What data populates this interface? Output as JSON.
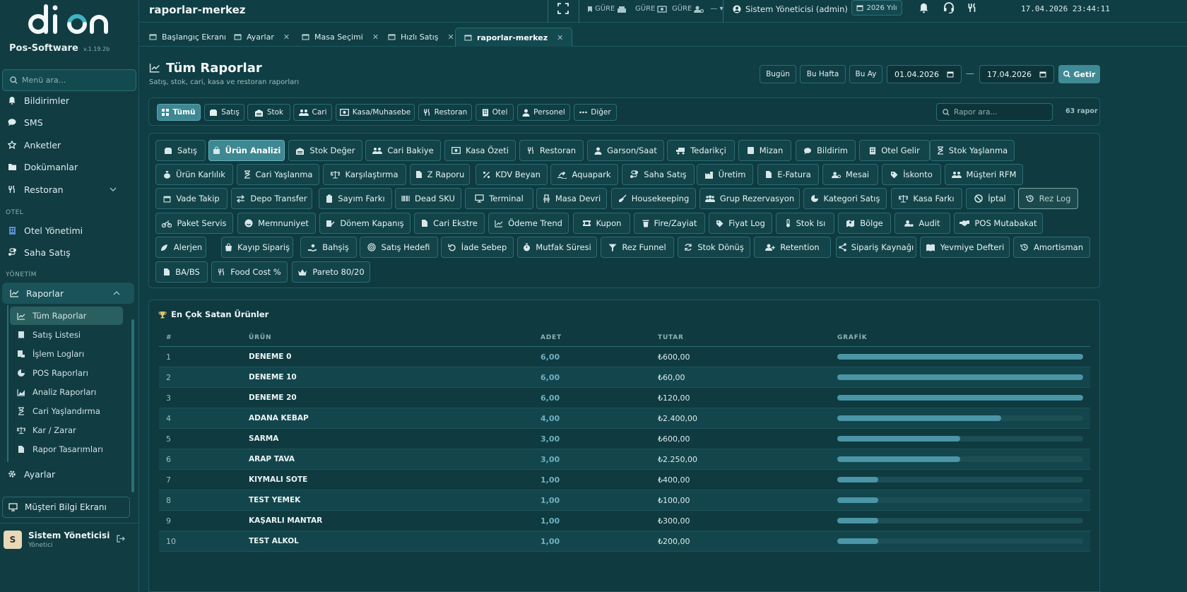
{
  "app": {
    "brand": "Pos-Software",
    "version": "v.1.19.2b"
  },
  "sidebar": {
    "search_placeholder": "Menü ara...",
    "items": [
      {
        "label": "Bildirimler",
        "icon": "bell-icon"
      },
      {
        "label": "SMS",
        "icon": "chat-icon"
      },
      {
        "label": "Anketler",
        "icon": "star-icon"
      },
      {
        "label": "Dokümanlar",
        "icon": "folder-icon"
      },
      {
        "label": "Restoran",
        "icon": "utensils-icon"
      }
    ],
    "section_otel": "OTEL",
    "otel_items": [
      {
        "label": "Otel Yönetimi",
        "icon": "building-icon"
      },
      {
        "label": "Saha Satış",
        "icon": "route-icon"
      }
    ],
    "section_yonetim": "YÖNETİM",
    "raporlar": {
      "label": "Raporlar",
      "icon": "chart-line-icon"
    },
    "sub_items": [
      {
        "label": "Tüm Raporlar"
      },
      {
        "label": "Satış Listesi"
      },
      {
        "label": "İşlem Logları"
      },
      {
        "label": "POS Raporları"
      },
      {
        "label": "Analiz Raporları"
      },
      {
        "label": "Cari Yaşlandırma"
      },
      {
        "label": "Kar / Zarar"
      },
      {
        "label": "Rapor Tasarımları"
      }
    ],
    "ayarlar": "Ayarlar",
    "musteri_ekrani": "Müşteri Bilgi Ekranı",
    "user": {
      "initial": "S",
      "name": "Sistem Yöneticisi",
      "role": "Yönetici"
    }
  },
  "topbar": {
    "title": "raporlar-merkez",
    "gure_label": "GÜRE",
    "admin_label": "Sistem Yöneticisi (admin)",
    "year": "2026 Yılı",
    "clock": "17.04.2026 23:44:11"
  },
  "tabs": [
    {
      "label": "Başlangıç Ekranı",
      "closable": false
    },
    {
      "label": "Ayarlar",
      "closable": true
    },
    {
      "label": "Masa Seçimi",
      "closable": true
    },
    {
      "label": "Hızlı Satış",
      "closable": true
    },
    {
      "label": "raporlar-merkez",
      "closable": true,
      "active": true
    }
  ],
  "header": {
    "title": "Tüm Raporlar",
    "subtitle": "Satış, stok, cari, kasa ve restoran raporları",
    "btn_today": "Bugün",
    "btn_week": "Bu Hafta",
    "btn_month": "Bu Ay",
    "date_from": "01.04.2026",
    "date_to": "17.04.2026",
    "btn_fetch": "Getir"
  },
  "filters": {
    "items": [
      "Tümü",
      "Satış",
      "Stok",
      "Cari",
      "Kasa/Muhasebe",
      "Restoran",
      "Otel",
      "Personel",
      "Diğer"
    ],
    "active": "Tümü",
    "search_placeholder": "Rapor ara...",
    "count": "63 rapor"
  },
  "reports": [
    [
      "Satış",
      "Ürün Analizi",
      "Stok Değer",
      "Cari Bakiye",
      "Kasa Özeti",
      "Restoran",
      "Garson/Saat",
      "Tedarikçi",
      "Mizan",
      "Bildirim",
      "Otel Gelir",
      "Stok Yaşlanma"
    ],
    [
      "Ürün Karlılık",
      "Cari Yaşlanma",
      "Karşılaştırma",
      "Z Raporu",
      "KDV Beyan",
      "Aquapark",
      "Saha Satış",
      "Üretim",
      "E-Fatura",
      "Mesai",
      "İskonto",
      "Müşteri RFM"
    ],
    [
      "Vade Takip",
      "Depo Transfer",
      "Sayım Farkı",
      "Dead SKU",
      "Terminal",
      "Masa Devri",
      "Housekeeping",
      "Grup Rezervasyon",
      "Kategori Satış",
      "Kasa Farkı",
      "İptal",
      "Rez Log"
    ],
    [
      "Paket Servis",
      "Memnuniyet",
      "Dönem Kapanış",
      "Cari Ekstre",
      "Ödeme Trend",
      "Kupon",
      "Fire/Zayiat",
      "Fiyat Log",
      "Stok Isı",
      "Bölge",
      "Audit",
      "POS Mutabakat"
    ],
    [
      "Alerjen",
      "Kayıp Sipariş",
      "Bahşiş",
      "Satış Hedefi",
      "İade Sebep",
      "Mutfak Süresi",
      "Rez Funnel",
      "Stok Dönüş",
      "Retention",
      "Sipariş Kaynağı",
      "Yevmiye Defteri",
      "Amortisman"
    ],
    [
      "BA/BS",
      "Food Cost %",
      "Pareto 80/20"
    ]
  ],
  "active_report": "Ürün Analizi",
  "table": {
    "title": "En Çok Satan Ürünler",
    "columns": [
      "#",
      "ÜRÜN",
      "ADET",
      "TUTAR",
      "GRAFİK"
    ],
    "rows": [
      {
        "idx": "1",
        "name": "DENEME 0",
        "qty": "6,00",
        "amount": "₺600,00",
        "ratio": 1.0
      },
      {
        "idx": "2",
        "name": "DENEME 10",
        "qty": "6,00",
        "amount": "₺60,00",
        "ratio": 1.0
      },
      {
        "idx": "3",
        "name": "DENEME 20",
        "qty": "6,00",
        "amount": "₺120,00",
        "ratio": 1.0
      },
      {
        "idx": "4",
        "name": "ADANA KEBAP",
        "qty": "4,00",
        "amount": "₺2.400,00",
        "ratio": 0.667
      },
      {
        "idx": "5",
        "name": "SARMA",
        "qty": "3,00",
        "amount": "₺600,00",
        "ratio": 0.5
      },
      {
        "idx": "6",
        "name": "ARAP TAVA",
        "qty": "3,00",
        "amount": "₺2.250,00",
        "ratio": 0.5
      },
      {
        "idx": "7",
        "name": "KIYMALI SOTE",
        "qty": "1,00",
        "amount": "₺400,00",
        "ratio": 0.167
      },
      {
        "idx": "8",
        "name": "TEST YEMEK",
        "qty": "1,00",
        "amount": "₺100,00",
        "ratio": 0.167
      },
      {
        "idx": "9",
        "name": "KAŞARLI MANTAR",
        "qty": "1,00",
        "amount": "₺300,00",
        "ratio": 0.167
      },
      {
        "idx": "10",
        "name": "TEST ALKOL",
        "qty": "1,00",
        "amount": "₺200,00",
        "ratio": 0.167
      }
    ]
  },
  "colors": {
    "accent": "#3d8893",
    "bar": "#4a95a6",
    "background": "#0f3e44"
  }
}
